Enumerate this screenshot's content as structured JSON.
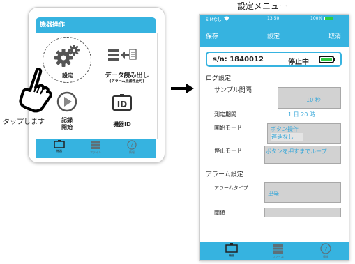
{
  "left_screen": {
    "header": "機器操作",
    "settings_label": "設定",
    "data_read_label": "データ読み出し",
    "data_read_sub": "(アラーム点滅停止可)",
    "record_start_label_1": "記録",
    "record_start_label_2": "開始",
    "device_id_label": "機器ID",
    "id_icon_text": "ID",
    "tap_label": "タップします",
    "tabs": [
      {
        "label": "機器"
      },
      {
        "label": "ファイル"
      },
      {
        "label": "情報"
      }
    ]
  },
  "right_screen": {
    "title": "設定メニュー",
    "status_bar": {
      "carrier": "SIMなし",
      "time": "13:50",
      "battery": "100%"
    },
    "nav": {
      "save": "保存",
      "title": "設定",
      "cancel": "取消"
    },
    "serial": "s/n: 1840012",
    "state": "停止中",
    "log_settings": {
      "heading": "ログ設定",
      "sample_interval_label": "サンプル間隔",
      "sample_interval_value": "10 秒",
      "measure_period_label": "測定期間",
      "measure_period_value": "1 日 20 時",
      "start_mode_label": "開始モード",
      "start_mode_value_1": "ボタン操作",
      "start_mode_value_2": "遅延なし",
      "stop_mode_label": "停止モード",
      "stop_mode_value": "ボタンを押すまでループ"
    },
    "alarm_settings": {
      "heading": "アラーム設定",
      "alarm_type_label": "アラームタイプ",
      "alarm_type_value": "単発",
      "threshold_label": "閾値",
      "threshold_value": ""
    },
    "tabs": [
      {
        "label": "機器"
      },
      {
        "label": "ファイル"
      },
      {
        "label": "情報"
      }
    ]
  },
  "colors": {
    "accent": "#36b3e0",
    "field": "#d2d2d2",
    "value_text": "#36a7d9",
    "battery": "#2ecc40"
  }
}
